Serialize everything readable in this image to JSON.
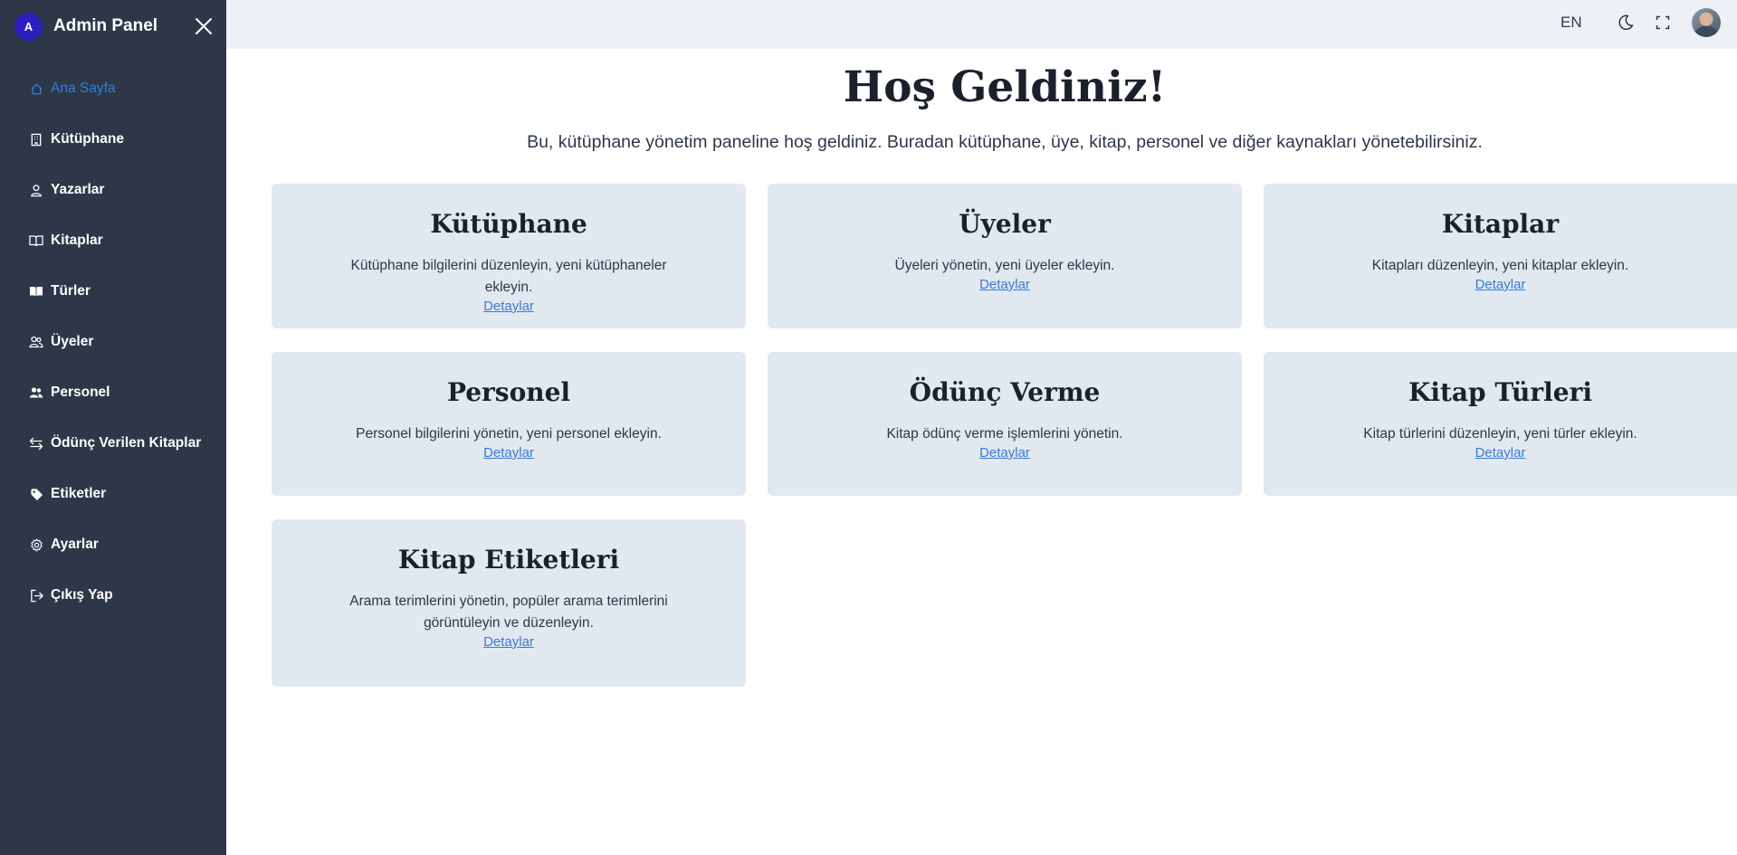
{
  "sidebar": {
    "logo_letter": "A",
    "title": "Admin Panel",
    "items": [
      {
        "label": "Ana Sayfa",
        "icon": "home-icon",
        "active": true
      },
      {
        "label": "Kütüphane",
        "icon": "building-icon",
        "active": false
      },
      {
        "label": "Yazarlar",
        "icon": "user-icon",
        "active": false
      },
      {
        "label": "Kitaplar",
        "icon": "book-open-icon",
        "active": false
      },
      {
        "label": "Türler",
        "icon": "book-filled-icon",
        "active": false
      },
      {
        "label": "Üyeler",
        "icon": "users-icon",
        "active": false
      },
      {
        "label": "Personel",
        "icon": "users-filled-icon",
        "active": false
      },
      {
        "label": "Ödünç Verilen Kitaplar",
        "icon": "swap-arrows-icon",
        "active": false
      },
      {
        "label": "Etiketler",
        "icon": "tag-icon",
        "active": false
      },
      {
        "label": "Ayarlar",
        "icon": "gear-icon",
        "active": false
      },
      {
        "label": "Çıkış Yap",
        "icon": "logout-icon",
        "active": false
      }
    ]
  },
  "topbar": {
    "language": "EN"
  },
  "main": {
    "title": "Hoş Geldiniz!",
    "subtitle": "Bu, kütüphane yönetim paneline hoş geldiniz. Buradan kütüphane, üye, kitap, personel ve diğer kaynakları yönetebilirsiniz.",
    "cards": [
      {
        "title": "Kütüphane",
        "description": "Kütüphane bilgilerini düzenleyin, yeni kütüphaneler ekleyin.",
        "link": "Detaylar"
      },
      {
        "title": "Üyeler",
        "description": "Üyeleri yönetin, yeni üyeler ekleyin.",
        "link": "Detaylar"
      },
      {
        "title": "Kitaplar",
        "description": "Kitapları düzenleyin, yeni kitaplar ekleyin.",
        "link": "Detaylar"
      },
      {
        "title": "Personel",
        "description": "Personel bilgilerini yönetin, yeni personel ekleyin.",
        "link": "Detaylar"
      },
      {
        "title": "Ödünç Verme",
        "description": "Kitap ödünç verme işlemlerini yönetin.",
        "link": "Detaylar"
      },
      {
        "title": "Kitap Türleri",
        "description": "Kitap türlerini düzenleyin, yeni türler ekleyin.",
        "link": "Detaylar"
      },
      {
        "title": "Kitap Etiketleri",
        "description": "Arama terimlerini yönetin, popüler arama terimlerini görüntüleyin ve düzenleyin.",
        "link": "Detaylar"
      }
    ]
  }
}
